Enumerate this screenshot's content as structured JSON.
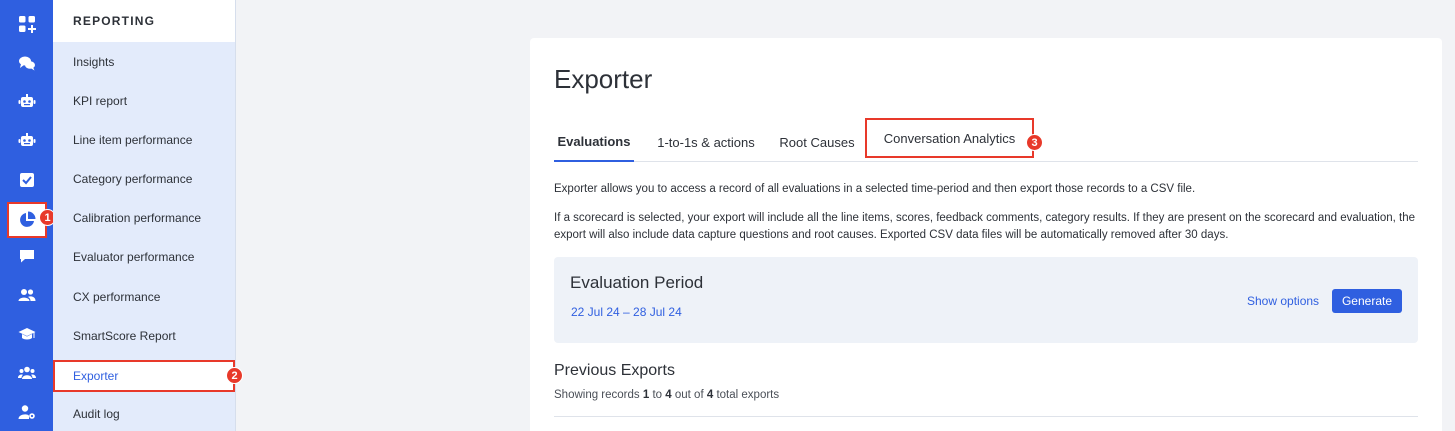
{
  "rail": {
    "icons": [
      "dashboard-add-icon",
      "chat-bubbles-icon",
      "robot-icon",
      "robot-alt-icon",
      "checkbox-icon",
      "pie-chart-icon",
      "message-icon",
      "users-icon",
      "graduation-cap-icon",
      "team-icon",
      "user-settings-icon"
    ],
    "active_index": 5
  },
  "sidebar": {
    "header": "REPORTING",
    "items": [
      {
        "label": "Insights"
      },
      {
        "label": "KPI report"
      },
      {
        "label": "Line item performance"
      },
      {
        "label": "Category performance"
      },
      {
        "label": "Calibration performance"
      },
      {
        "label": "Evaluator performance"
      },
      {
        "label": "CX performance"
      },
      {
        "label": "SmartScore Report"
      },
      {
        "label": "Exporter"
      },
      {
        "label": "Audit log"
      }
    ],
    "active_index": 8
  },
  "callouts": [
    "1",
    "2",
    "3"
  ],
  "main": {
    "title": "Exporter",
    "tabs": [
      {
        "label": "Evaluations"
      },
      {
        "label": "1-to-1s & actions"
      },
      {
        "label": "Root Causes"
      },
      {
        "label": "Conversation Analytics"
      }
    ],
    "intro": "Exporter allows you to access a record of all evaluations in a selected time-period and then export those records to a CSV file.",
    "detail": "If a scorecard is selected, your export will include all the line items, scores, feedback comments, category results. If they are present on the scorecard and evaluation, the export will also include data capture questions and root causes. Exported CSV data files will be automatically removed after 30 days.",
    "period": {
      "title": "Evaluation Period",
      "range": "22 Jul 24 – 28 Jul 24",
      "show_options": "Show options",
      "generate": "Generate"
    },
    "previous": {
      "title": "Previous Exports",
      "prefix": "Showing records",
      "from": "1",
      "to_word": "to",
      "to": "4",
      "out_of": "out of",
      "total": "4",
      "suffix": "total exports"
    }
  },
  "colors": {
    "brand": "#2f5fe0",
    "highlight": "#e8392a"
  }
}
